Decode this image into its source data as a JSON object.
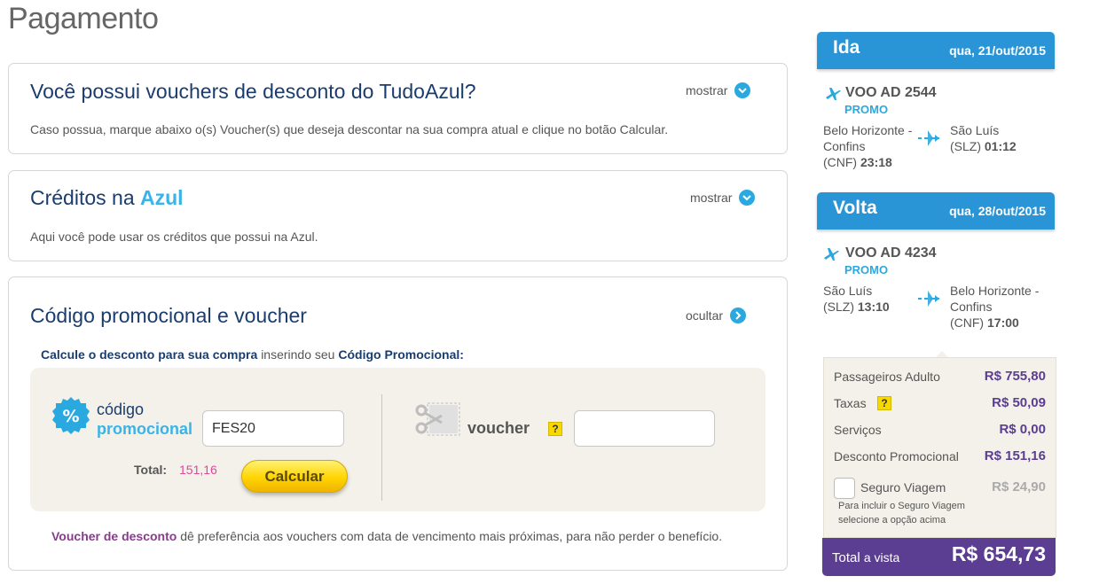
{
  "page_title": "Pagamento",
  "vouchers_panel": {
    "title": "Você possui vouchers de desconto do TudoAzul?",
    "toggle_label": "mostrar",
    "description": "Caso possua, marque abaixo o(s) Voucher(s) que deseja descontar na sua compra atual e clique no botão Calcular."
  },
  "creditos_panel": {
    "title_prefix": "Créditos na",
    "title_brand": "Azul",
    "toggle_label": "mostrar",
    "description": "Aqui você pode usar os créditos que possui na Azul."
  },
  "promo_panel": {
    "title": "Código promocional e voucher",
    "toggle_label": "ocultar",
    "head_bold": "Calcule o desconto para sua compra",
    "head_mid": "inserindo seu",
    "head_code": "Código Promocional:",
    "code_label_1": "código",
    "code_label_2": "promocional",
    "code_value": "FES20",
    "total_label": "Total:",
    "total_value": "151,16",
    "calc_button": "Calcular",
    "voucher_label": "voucher",
    "help_mark": "?",
    "voucher_value": "",
    "note_bold": "Voucher de desconto",
    "note_text": "dê preferência aos vouchers com data de vencimento mais próximas, para não perder o benefício."
  },
  "flights": {
    "ida": {
      "direction": "Ida",
      "date": "qua, 21/out/2015",
      "flight_no": "VOO AD 2544",
      "fare": "PROMO",
      "origin_line1": "Belo Horizonte -",
      "origin_line2": "Confins",
      "origin_code": "(CNF)",
      "origin_time": "23:18",
      "dest_line1": "São Luís",
      "dest_code": "(SLZ)",
      "dest_time": "01:12"
    },
    "volta": {
      "direction": "Volta",
      "date": "qua, 28/out/2015",
      "flight_no": "VOO AD 4234",
      "fare": "PROMO",
      "origin_line1": "São Luís",
      "origin_code": "(SLZ)",
      "origin_time": "13:10",
      "dest_line1": "Belo Horizonte -",
      "dest_line2": "Confins",
      "dest_code": "(CNF)",
      "dest_time": "17:00"
    }
  },
  "price_summary": {
    "passageiros_label": "Passageiros Adulto",
    "passageiros_value": "R$ 755,80",
    "taxas_label": "Taxas",
    "taxas_value": "R$ 50,09",
    "servicos_label": "Serviços",
    "servicos_value": "R$ 0,00",
    "desconto_label": "Desconto Promocional",
    "desconto_value": "R$ 151,16",
    "seguro_label": "Seguro Viagem",
    "seguro_value": "R$ 24,90",
    "seguro_note_1": "Para incluir o Seguro Viagem",
    "seguro_note_2": "selecione a opção acima",
    "total_label_1": "Total",
    "total_label_2": "a vista",
    "total_value": "R$ 654,73"
  },
  "colors": {
    "brand_blue": "#2a95d6",
    "light_blue": "#3ab4e6",
    "navy": "#1a3d6e",
    "purple": "#5b3d91",
    "pink": "#e0479a",
    "yellow": "#ffd400"
  },
  "icons": [
    "chevron-down-icon",
    "chevron-right-icon",
    "percent-badge-icon",
    "scissors-icon",
    "plane-icon",
    "route-arrow-icon",
    "help-icon"
  ]
}
